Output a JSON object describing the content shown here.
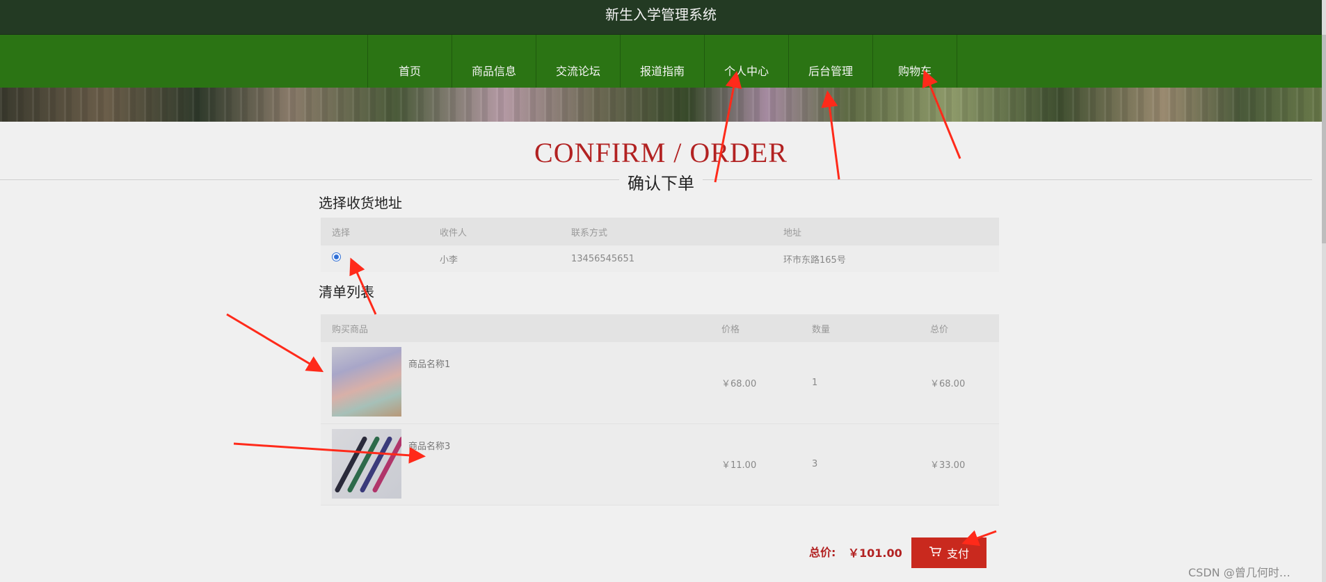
{
  "app": {
    "title": "新生入学管理系统"
  },
  "nav": [
    "首页",
    "商品信息",
    "交流论坛",
    "报道指南",
    "个人中心",
    "后台管理",
    "购物车"
  ],
  "page": {
    "title": "CONFIRM / ORDER",
    "subtitle": "确认下单"
  },
  "address_section": {
    "title": "选择收货地址",
    "columns": [
      "选择",
      "收件人",
      "联系方式",
      "地址"
    ],
    "rows": [
      {
        "selected": true,
        "recipient": "小李",
        "phone": "13456545651",
        "address": "环市东路165号"
      }
    ]
  },
  "items_section": {
    "title": "清单列表",
    "columns": [
      "购买商品",
      "价格",
      "数量",
      "总价"
    ],
    "rows": [
      {
        "name": "商品名称1",
        "price": "￥68.00",
        "qty": "1",
        "total": "￥68.00"
      },
      {
        "name": "商品名称3",
        "price": "￥11.00",
        "qty": "3",
        "total": "￥33.00"
      }
    ]
  },
  "summary": {
    "label": "总价:",
    "value": "￥101.00"
  },
  "pay_button": {
    "label": "支付",
    "icon": "cart-icon"
  },
  "watermark": "CSDN @曾几何时…",
  "colors": {
    "header_dark": "#233a23",
    "nav_green": "#2b7414",
    "accent_red": "#c9291e",
    "title_red": "#b22222",
    "annotation_red": "#ff2a1a"
  }
}
